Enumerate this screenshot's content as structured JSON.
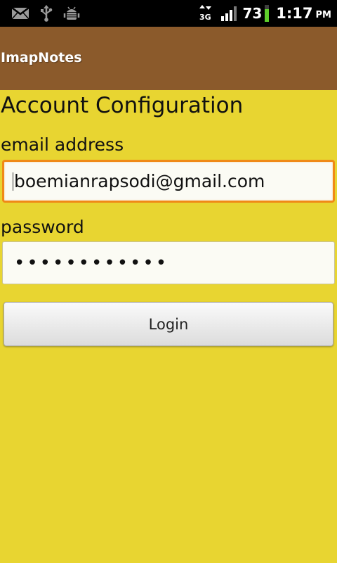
{
  "status_bar": {
    "icons": [
      "gmail-icon",
      "usb-icon",
      "android-debug-icon",
      "data-3g-icon",
      "signal-icon",
      "battery-icon"
    ],
    "network": "3G",
    "battery_percent": "73",
    "time": "1:17",
    "ampm": "PM"
  },
  "app": {
    "title": "ImapNotes",
    "bar_color": "#8b5a2b",
    "background_color": "#e8d531"
  },
  "form": {
    "heading": "Account Configuration",
    "email_label": "email address",
    "email_value": "boemianrapsodi@gmail.com",
    "password_label": "password",
    "password_value": "••••••••••••",
    "login_label": "Login"
  }
}
